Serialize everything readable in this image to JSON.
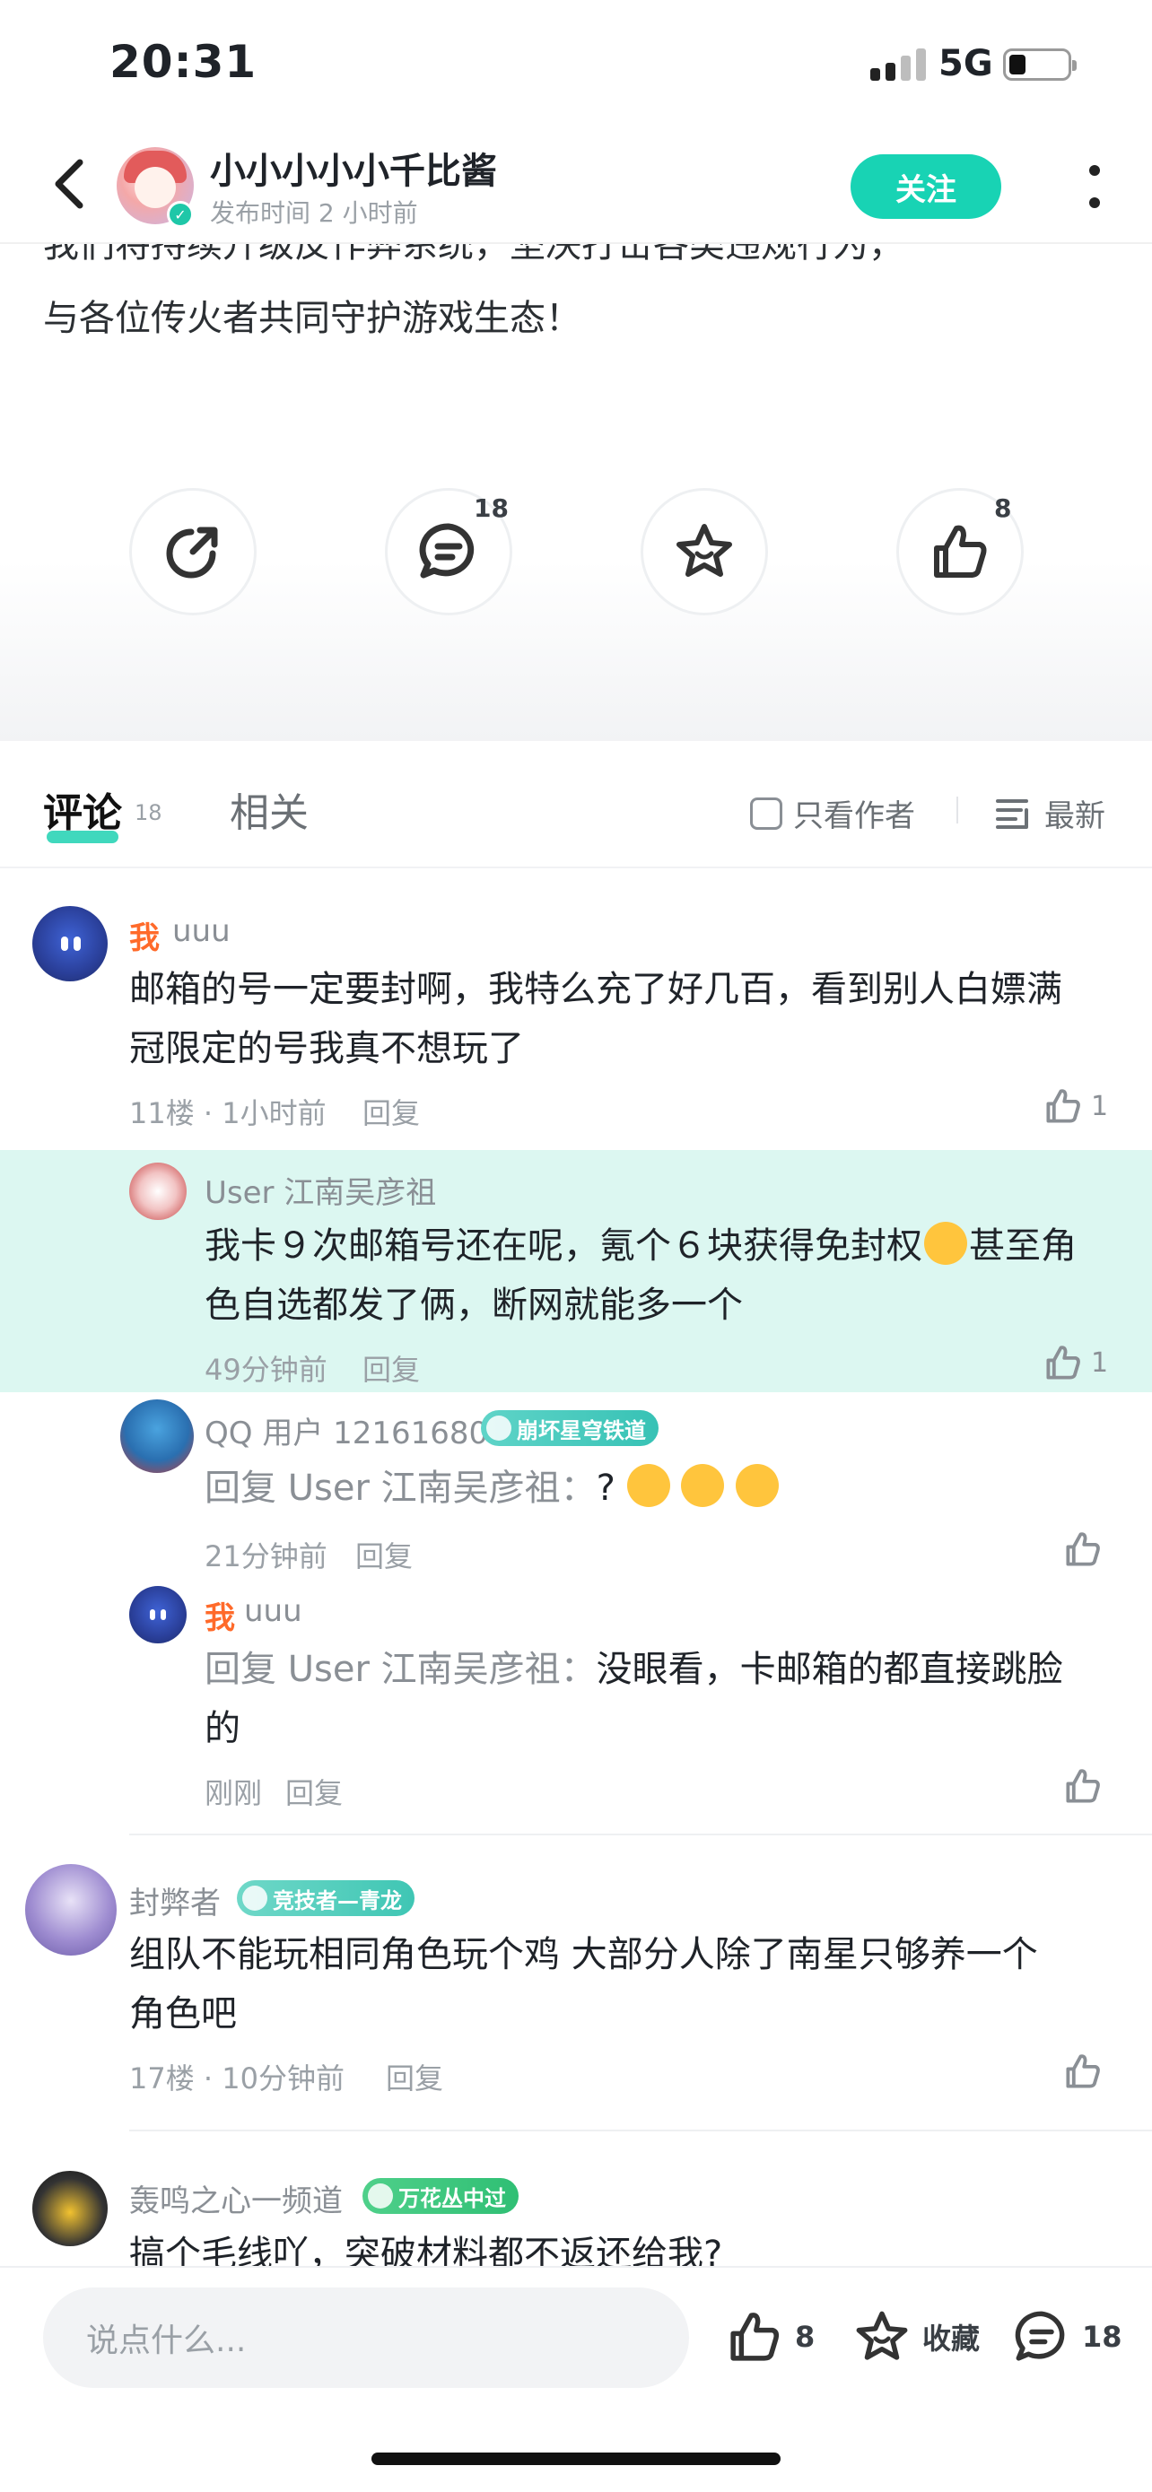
{
  "status_bar": {
    "time": "20:31",
    "network": "5G"
  },
  "header": {
    "author_name": "小小小小小千比酱",
    "post_time": "发布时间 2 小时前",
    "follow_label": "关注"
  },
  "article": {
    "line1": "我们将持续升级反作弊系统，坚决打击各类违规行为，",
    "line2": "与各位传火者共同守护游戏生态！"
  },
  "actions": {
    "share_icon": "share-icon",
    "comment_count": "18",
    "like_count": "8"
  },
  "tabs": {
    "comment_label": "评论",
    "comment_count": "18",
    "related_label": "相关",
    "only_author_label": "只看作者",
    "sort_label": "最新"
  },
  "comments": [
    {
      "me": "我",
      "name": "uuu",
      "text_line1": "邮箱的号一定要封啊，我特么充了好几百，看到别人白嫖满",
      "text_line2": "冠限定的号我真不想玩了",
      "meta": "11楼 · 1小时前",
      "reply_label": "回复",
      "likes": "1"
    },
    {
      "name": "User  江南吴彦祖",
      "text_line1": "我卡９次邮箱号还在呢，氪个６块获得免封权",
      "text_line1_after": "甚至角",
      "text_line2": "色自选都发了俩，断网就能多一个",
      "meta": "49分钟前",
      "reply_label": "回复",
      "likes": "1"
    },
    {
      "name": "QQ 用户 12161680",
      "badge": "崩坏星穹铁道",
      "reply_prefix": "回复 User  江南吴彦祖：",
      "text": "?",
      "meta": "21分钟前",
      "reply_label": "回复"
    },
    {
      "me": "我",
      "name": "uuu",
      "reply_prefix": "回复 User  江南吴彦祖：",
      "text_line1": "没眼看，卡邮箱的都直接跳脸",
      "text_line2": "的",
      "meta": "刚刚",
      "reply_label": "回复"
    },
    {
      "name": "封弊者",
      "badge": "竞技者—青龙",
      "text_line1": "组队不能玩相同角色玩个鸡 大部分人除了南星只够养一个",
      "text_line2": "角色吧",
      "meta": "17楼 · 10分钟前",
      "reply_label": "回复"
    },
    {
      "name": "轰鸣之心一频道",
      "badge": "万花丛中过",
      "text_line1": "搞个毛线吖，突破材料都不返还给我?"
    }
  ],
  "bottom_bar": {
    "input_placeholder": "说点什么...",
    "like_count": "8",
    "favorite_label": "收藏",
    "comment_count": "18"
  },
  "colors": {
    "accent": "#18d3b4",
    "highlight": "#dcf7f1",
    "me_label": "#ff6a2a"
  }
}
